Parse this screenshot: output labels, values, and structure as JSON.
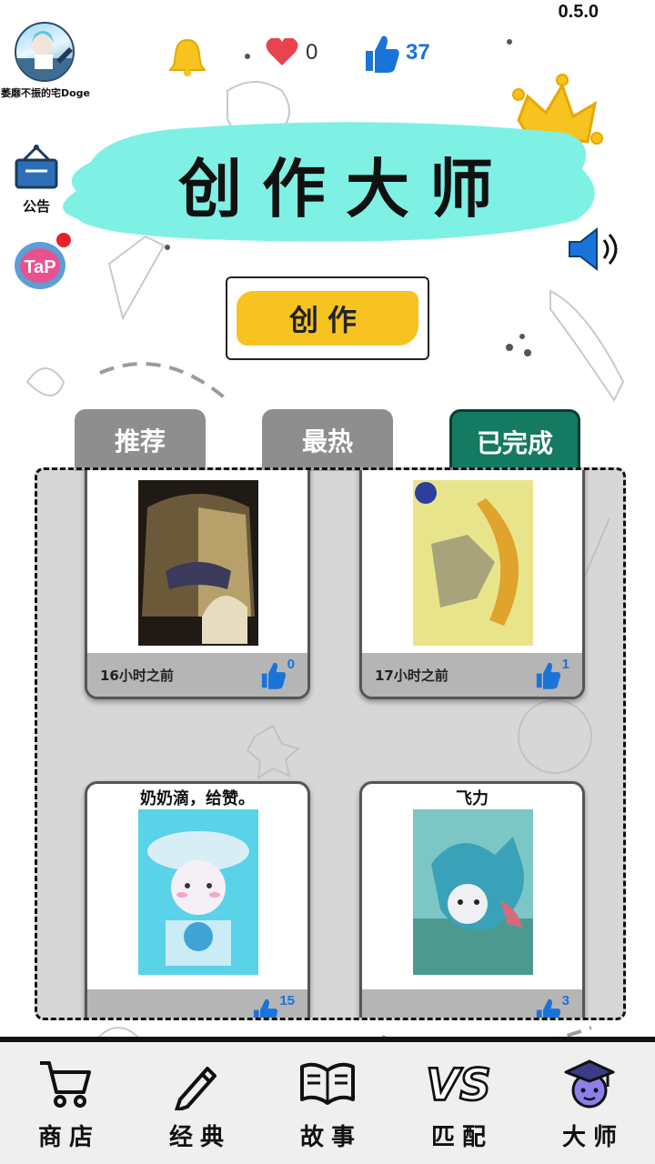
{
  "version": "0.5.0",
  "user": {
    "name": "萎靡不振的宅Doge"
  },
  "stats": {
    "hearts": "0",
    "likes": "37"
  },
  "notice": {
    "label": "公告"
  },
  "tap_badge": {
    "text": "TaP"
  },
  "title": "创作大师",
  "create_button": {
    "label": "创作"
  },
  "tabs": [
    {
      "label": "推荐",
      "active": false
    },
    {
      "label": "最热",
      "active": false
    },
    {
      "label": "已完成",
      "active": true
    }
  ],
  "cards": [
    {
      "caption": "",
      "time": "16小时之前",
      "likes": "0",
      "art": "hooded-figure-drawing"
    },
    {
      "caption": "",
      "time": "17小时之前",
      "likes": "1",
      "art": "yellow-cat-drawing"
    },
    {
      "caption": "奶奶滴，给赞。",
      "time": "",
      "likes": "15",
      "art": "cinnamoroll-drawing"
    },
    {
      "caption": "飞力",
      "time": "",
      "likes": "3",
      "art": "blue-character-drawing"
    }
  ],
  "nav": [
    {
      "label": "商店",
      "icon": "cart-icon"
    },
    {
      "label": "经典",
      "icon": "pencil-icon"
    },
    {
      "label": "故事",
      "icon": "book-icon"
    },
    {
      "label": "匹配",
      "icon": "vs-icon"
    },
    {
      "label": "大师",
      "icon": "graduate-icon"
    }
  ],
  "colors": {
    "banner": "#7ff0e4",
    "create_fill": "#f6c320",
    "tab_active": "#147a61",
    "tab_inactive": "#8e8e8e",
    "like_blue": "#1a73d9"
  }
}
